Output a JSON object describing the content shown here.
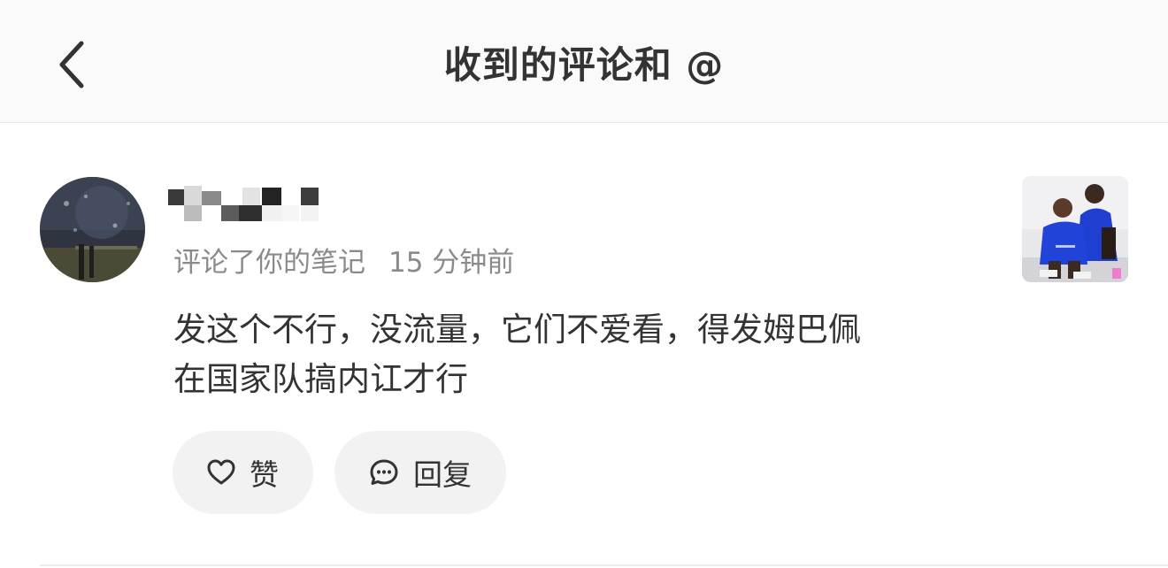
{
  "header": {
    "title": "收到的评论和 @",
    "back_icon": "chevron-left-icon"
  },
  "notification": {
    "action_text": "评论了你的笔记",
    "time_text": "15 分钟前",
    "comment_lines": [
      "发这个不行，没流量，它们不爱看，得发姆巴佩",
      "在国家队搞内讧才行"
    ],
    "like_label": "赞",
    "reply_label": "回复",
    "like_icon": "heart-outline-icon",
    "reply_icon": "speech-bubble-dots-icon"
  },
  "colors": {
    "header_bg": "#fafafa",
    "text_primary": "#333333",
    "text_secondary": "#8a8a8a",
    "pill_bg": "#f2f2f3",
    "jersey_blue": "#1e3fd0"
  }
}
